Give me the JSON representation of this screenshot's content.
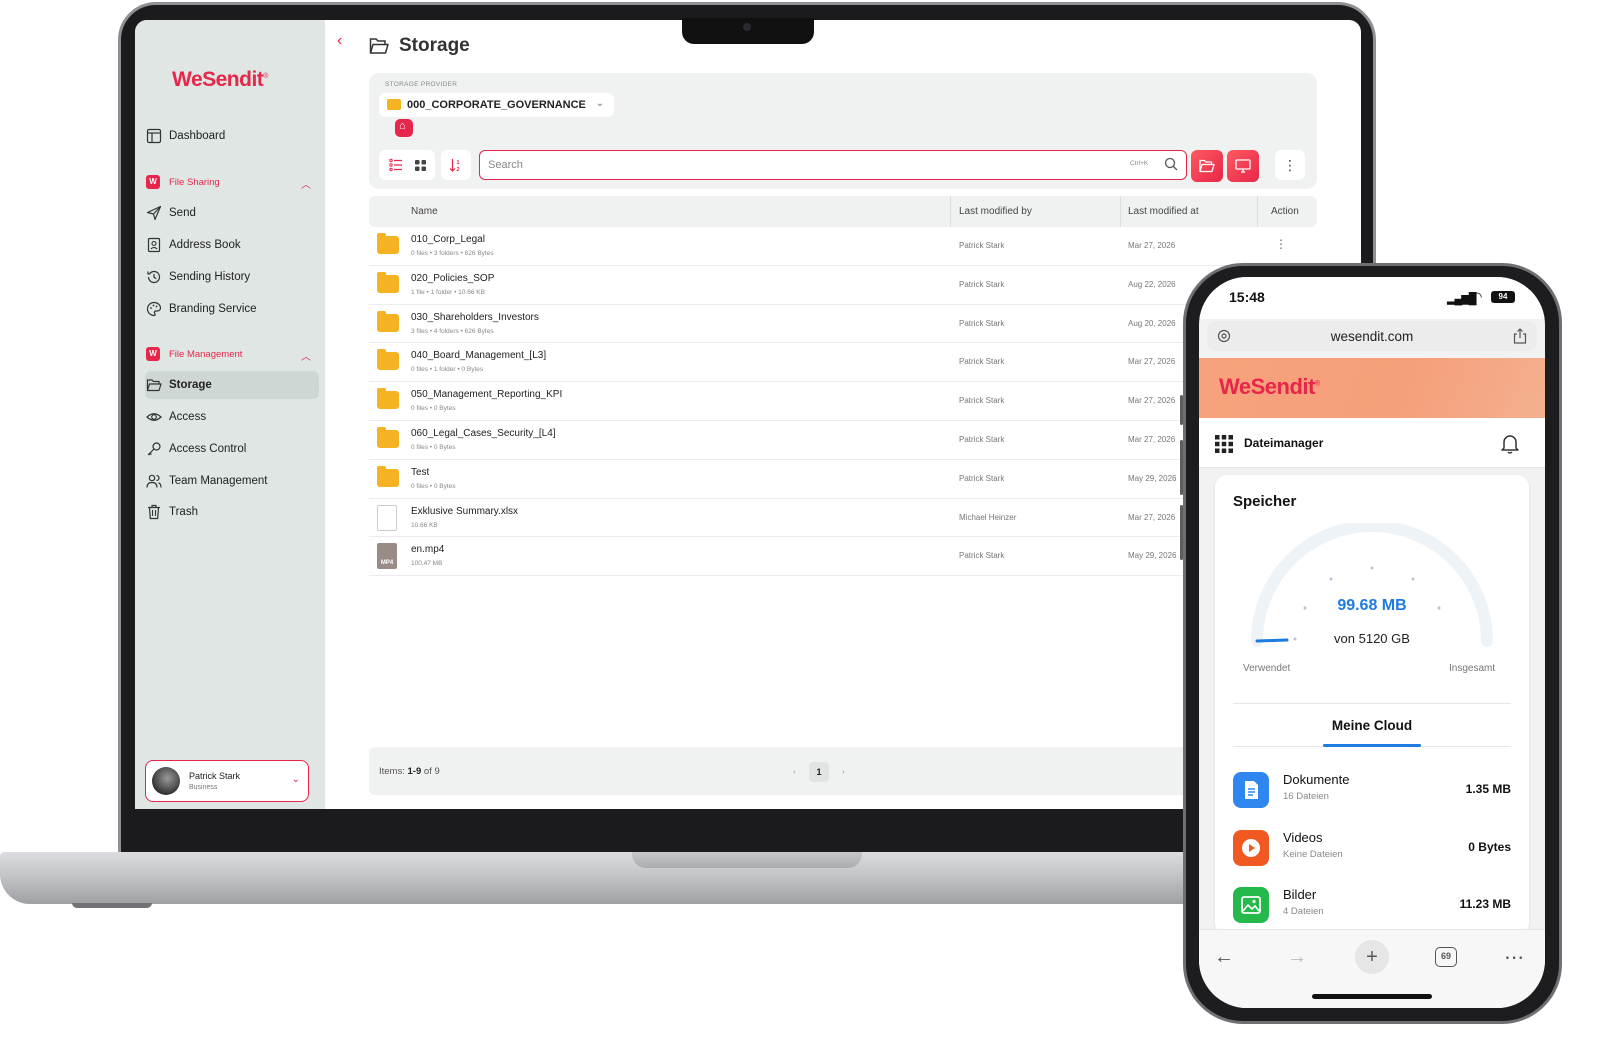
{
  "laptop": {
    "sidebar": {
      "logo": "WeSendit",
      "dashboard": "Dashboard",
      "group_file_sharing": "File Sharing",
      "send": "Send",
      "address_book": "Address Book",
      "sending_history": "Sending History",
      "branding_service": "Branding Service",
      "group_file_management": "File Management",
      "storage": "Storage",
      "access": "Access",
      "access_control": "Access Control",
      "team_management": "Team Management",
      "trash": "Trash",
      "user_name": "Patrick Stark",
      "user_role": "Business"
    },
    "header": {
      "title": "Storage"
    },
    "provider": {
      "label": "STORAGE PROVIDER",
      "selected": "000_CORPORATE_GOVERNANCE"
    },
    "toolbar": {
      "search_placeholder": "Search",
      "search_shortcut": "Ctrl+K"
    },
    "table": {
      "columns": [
        "Name",
        "Last modified by",
        "Last modified at",
        "Action"
      ],
      "rows": [
        {
          "name": "010_Corp_Legal",
          "meta": "0 files • 3 folders • 626 Bytes",
          "by": "Patrick Stark",
          "at": "Mar 27, 2026",
          "type": "folder"
        },
        {
          "name": "020_Policies_SOP",
          "meta": "1 file • 1 folder • 10.66 KB",
          "by": "Patrick Stark",
          "at": "Aug 22, 2026",
          "type": "folder"
        },
        {
          "name": "030_Shareholders_Investors",
          "meta": "3 files • 4 folders • 626 Bytes",
          "by": "Patrick Stark",
          "at": "Aug 20, 2026",
          "type": "folder"
        },
        {
          "name": "040_Board_Management_[L3]",
          "meta": "0 files • 1 folder • 0 Bytes",
          "by": "Patrick Stark",
          "at": "Mar 27, 2026",
          "type": "folder"
        },
        {
          "name": "050_Management_Reporting_KPI",
          "meta": "0 files • 0 Bytes",
          "by": "Patrick Stark",
          "at": "Mar 27, 2026",
          "type": "folder"
        },
        {
          "name": "060_Legal_Cases_Security_[L4]",
          "meta": "0 files • 0 Bytes",
          "by": "Patrick Stark",
          "at": "Mar 27, 2026",
          "type": "folder"
        },
        {
          "name": "Test",
          "meta": "0 files • 0 Bytes",
          "by": "Patrick Stark",
          "at": "May 29, 2026",
          "type": "folder"
        },
        {
          "name": "Exklusive Summary.xlsx",
          "meta": "10.66 KB",
          "by": "Michael Heinzer",
          "at": "Mar 27, 2026",
          "type": "doc"
        },
        {
          "name": "en.mp4",
          "meta": "100.47 MB",
          "by": "Patrick Stark",
          "at": "May 29, 2026",
          "type": "mp4"
        }
      ],
      "mp4_label": "MP4"
    },
    "pager": {
      "items_label": "Items:",
      "items_range": "1-9",
      "items_of": "of 9",
      "page": "1"
    }
  },
  "phone": {
    "time": "15:48",
    "battery": "94",
    "url": "wesendit.com",
    "logo": "WeSendit",
    "appbar_title": "Dateimanager",
    "card_title": "Speicher",
    "used_value": "99.68 MB",
    "total_value": "von 5120 GB",
    "used_label": "Verwendet",
    "total_label": "Insgesamt",
    "usage_fraction": 1.95e-05,
    "tab": "Meine Cloud",
    "items": [
      {
        "name": "Dokumente",
        "sub": "16 Dateien",
        "size": "1.35 MB",
        "color": "#2f86f0"
      },
      {
        "name": "Videos",
        "sub": "Keine Dateien",
        "size": "0 Bytes",
        "color": "#f05a22"
      },
      {
        "name": "Bilder",
        "sub": "4 Dateien",
        "size": "11.23 MB",
        "color": "#25b84a"
      }
    ],
    "tabs_count": "69"
  },
  "colors": {
    "brand": "#e6264a",
    "accent_blue": "#1e7be0",
    "folder": "#f5b323"
  }
}
